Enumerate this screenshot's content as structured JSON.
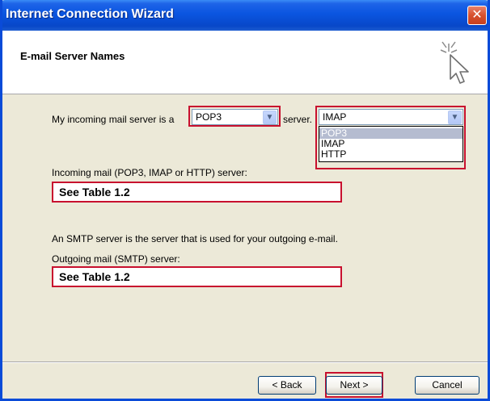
{
  "window": {
    "title": "Internet Connection Wizard",
    "close_glyph": "✕"
  },
  "header": {
    "title": "E-mail Server Names",
    "icon": "wizard-cursor-icon"
  },
  "incoming": {
    "prefix_label": "My incoming mail server is a",
    "type_value": "POP3",
    "server_label": "server.",
    "dropdown_value": "IMAP",
    "options": [
      "POP3",
      "IMAP",
      "HTTP"
    ],
    "highlighted_option": "POP3",
    "field_label": "Incoming mail (POP3, IMAP or HTTP) server:",
    "field_value": "See Table 1.2"
  },
  "outgoing": {
    "info_text": "An SMTP server is the server that is used for your outgoing e-mail.",
    "field_label": "Outgoing mail (SMTP) server:",
    "field_value": "See Table 1.2"
  },
  "buttons": {
    "back": "< Back",
    "next": "Next >",
    "cancel": "Cancel"
  },
  "colors": {
    "title_bar": "#0A55E0",
    "highlight_border": "#C8102E",
    "dialog_bg": "#ECE9D8"
  }
}
